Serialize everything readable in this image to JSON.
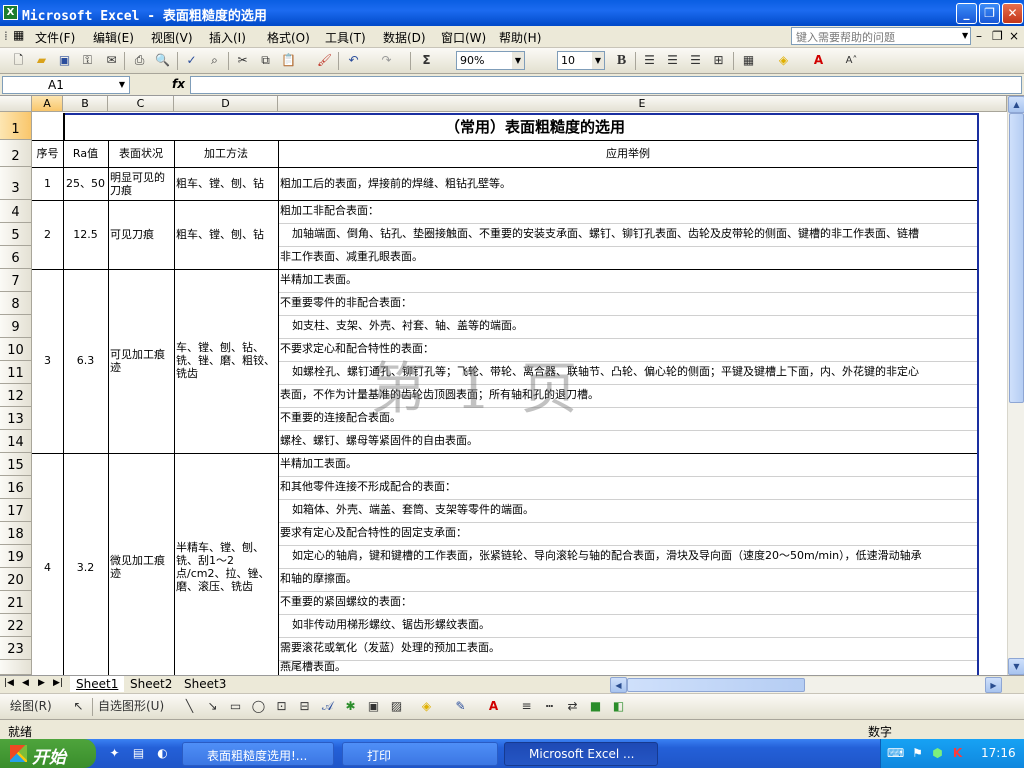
{
  "window": {
    "title": "Microsoft Excel - 表面粗糙度的选用",
    "minimize": "_",
    "restore": "❐",
    "close": "✕"
  },
  "menu": [
    "文件(F)",
    "编辑(E)",
    "视图(V)",
    "插入(I)",
    "格式(O)",
    "工具(T)",
    "数据(D)",
    "窗口(W)",
    "帮助(H)"
  ],
  "help_placeholder": "键入需要帮助的问题",
  "toolbar": {
    "zoom": "90%",
    "font_size": "10",
    "bold": "B",
    "sigma": "Σ"
  },
  "formula": {
    "cell_ref": "A1",
    "fx": "fx",
    "content": ""
  },
  "columns": [
    "A",
    "B",
    "C",
    "D",
    "E"
  ],
  "rows": [
    "1",
    "2",
    "3",
    "4",
    "5",
    "6",
    "7",
    "8",
    "9",
    "10",
    "11",
    "12",
    "13",
    "14",
    "15",
    "16",
    "17",
    "18",
    "19",
    "20",
    "21",
    "22",
    "23"
  ],
  "table": {
    "title": "（常用）表面粗糙度的选用",
    "headers": {
      "no": "序号",
      "ra": "Ra值",
      "surface": "表面状况",
      "method": "加工方法",
      "example": "应用举例"
    },
    "g1": {
      "no": "1",
      "ra": "25、50",
      "surface": "明显可见的刀痕",
      "method": "粗车、镗、刨、钻",
      "ex": [
        "粗加工后的表面，焊接前的焊缝、粗钻孔壁等。"
      ]
    },
    "g2": {
      "no": "2",
      "ra": "12.5",
      "surface": "可见刀痕",
      "method": "粗车、镗、刨、钻",
      "ex": [
        "粗加工非配合表面：",
        "加轴端面、倒角、钻孔、垫圈接触面、不重要的安装支承面、螺钉、铆钉孔表面、齿轮及皮带轮的侧面、键槽的非工作表面、链槽",
        "非工作表面、减重孔眼表面。"
      ]
    },
    "g3": {
      "no": "3",
      "ra": "6.3",
      "surface": "可见加工痕迹",
      "method": "车、镗、刨、钻、铣、锉、磨、粗铰、铣齿",
      "ex": [
        "半精加工表面。",
        "不重要零件的非配合表面：",
        "如支柱、支架、外壳、衬套、轴、盖等的端面。",
        "不要求定心和配合特性的表面：",
        "如螺栓孔、螺钉通孔、铆钉孔等；飞轮、带轮、离合器、联轴节、凸轮、偏心轮的侧面；平键及键槽上下面，内、外花键的非定心",
        "表面，不作为计量基准的齿轮齿顶圆表面；所有轴和孔的退刀槽。",
        "不重要的连接配合表面。",
        "螺栓、螺钉、螺母等紧固件的自由表面。"
      ]
    },
    "g4": {
      "no": "4",
      "ra": "3.2",
      "surface": "微见加工痕迹",
      "method": "半精车、镗、刨、铣、刮1～2点/cm2、拉、锉、磨、滚压、铣齿",
      "ex": [
        "半精加工表面。",
        "和其他零件连接不形成配合的表面：",
        "如箱体、外壳、端盖、套筒、支架等零件的端面。",
        "要求有定心及配合特性的固定支承面：",
        "如定心的轴肩，键和键槽的工作表面，张紧链轮、导向滚轮与轴的配合表面，滑块及导向面（速度20～50m/min），低速滑动轴承",
        "和轴的摩擦面。",
        "不重要的紧固螺纹的表面：",
        "如非传动用梯形螺纹、锯齿形螺纹表面。",
        "需要滚花或氧化（发蓝）处理的预加工表面。",
        "燕尾槽表面。"
      ]
    }
  },
  "watermark": "第 1 页",
  "sheets": [
    "Sheet1",
    "Sheet2",
    "Sheet3"
  ],
  "drawbar": {
    "draw": "绘图(R)",
    "autoshapes": "自选图形(U)"
  },
  "status": {
    "left": "就绪",
    "right": "数字"
  },
  "taskbar": {
    "start": "开始",
    "tasks": [
      "表面粗糙度选用!...",
      "打印",
      "Microsoft Excel ..."
    ],
    "clock": "17:16"
  }
}
